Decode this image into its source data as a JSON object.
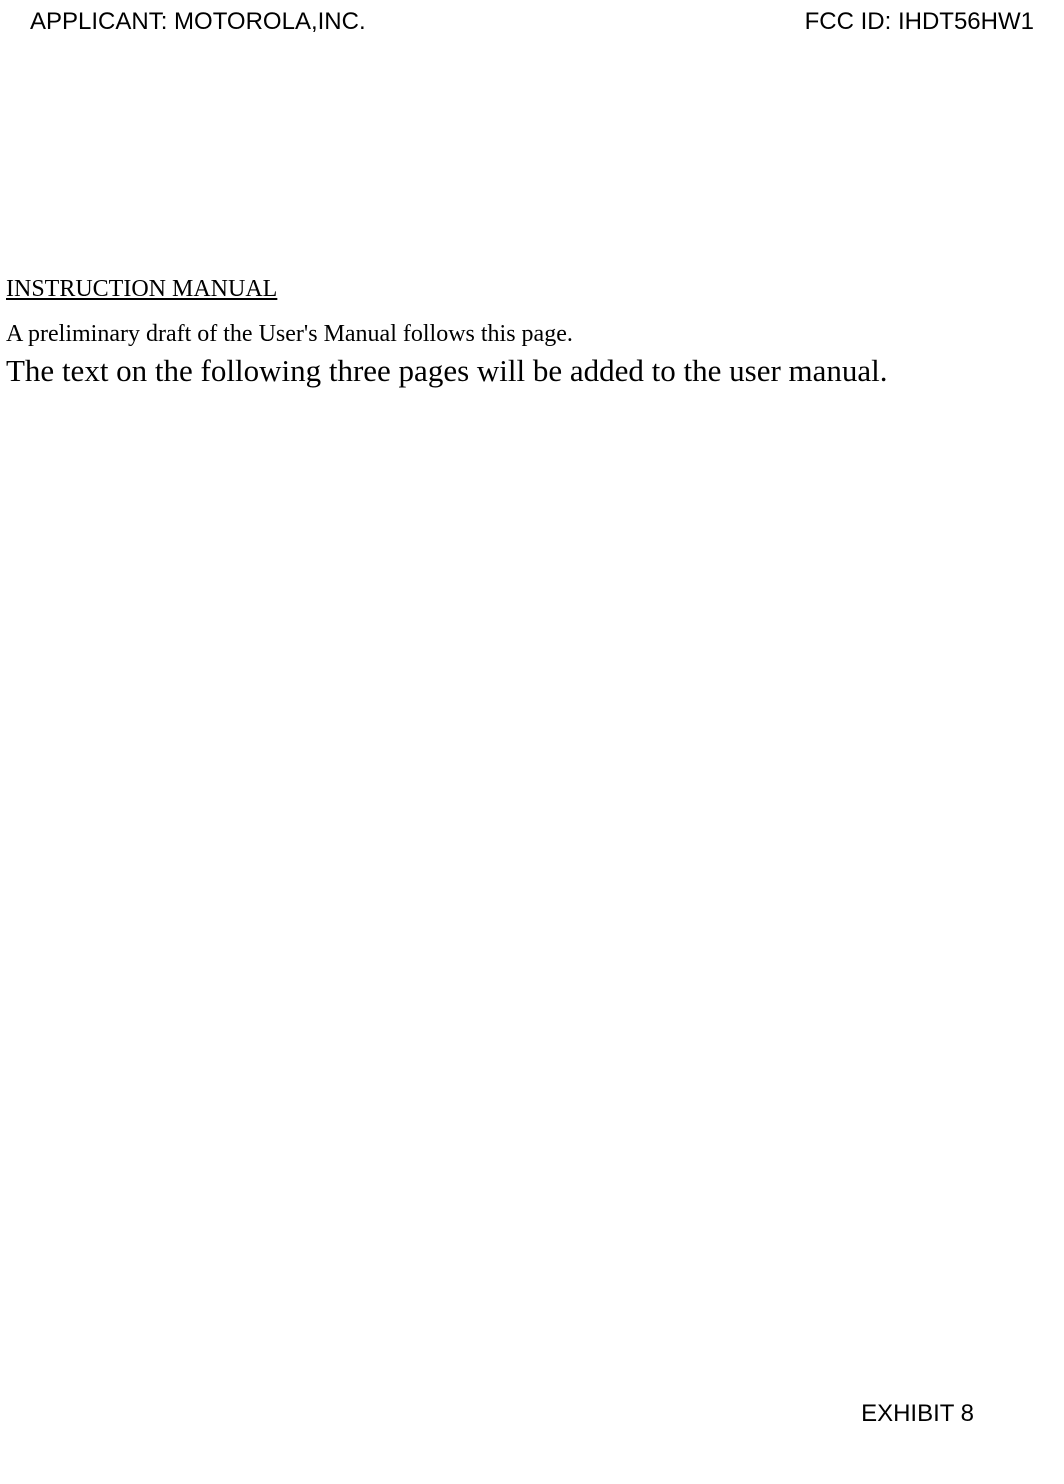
{
  "header": {
    "applicant_label": "APPLICANT: MOTOROLA,INC.",
    "fcc_id_label": "FCC ID: IHDT56HW1"
  },
  "content": {
    "heading": "INSTRUCTION MANUAL",
    "paragraph_small": "A preliminary draft of the User's Manual follows this page.",
    "paragraph_large": "The text on the following three pages will be added to the user manual."
  },
  "footer": {
    "exhibit_label": "EXHIBIT 8"
  }
}
